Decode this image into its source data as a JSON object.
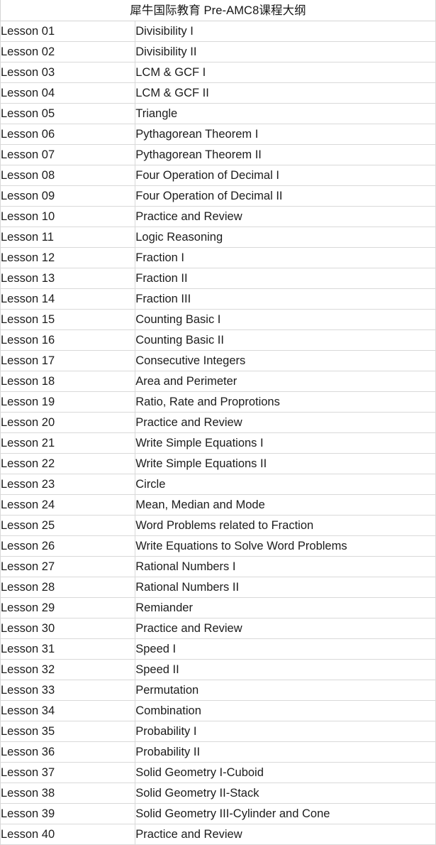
{
  "document": {
    "title": "犀牛国际教育 Pre-AMC8课程大纲",
    "border_color": "#d9d9d9",
    "text_color": "#1c1c1c",
    "background_color": "#ffffff"
  },
  "table": {
    "rows": [
      {
        "lesson": "Lesson 01",
        "topic": "Divisibility I"
      },
      {
        "lesson": "Lesson 02",
        "topic": "Divisibility II"
      },
      {
        "lesson": "Lesson 03",
        "topic": "LCM & GCF I"
      },
      {
        "lesson": "Lesson 04",
        "topic": "LCM & GCF II"
      },
      {
        "lesson": "Lesson 05",
        "topic": "Triangle"
      },
      {
        "lesson": "Lesson 06",
        "topic": "Pythagorean Theorem I"
      },
      {
        "lesson": "Lesson 07",
        "topic": "Pythagorean Theorem II"
      },
      {
        "lesson": "Lesson 08",
        "topic": "Four Operation of Decimal I"
      },
      {
        "lesson": "Lesson 09",
        "topic": "Four Operation of Decimal II"
      },
      {
        "lesson": "Lesson 10",
        "topic": "Practice and Review"
      },
      {
        "lesson": "Lesson 11",
        "topic": "Logic Reasoning"
      },
      {
        "lesson": "Lesson 12",
        "topic": "Fraction I"
      },
      {
        "lesson": "Lesson 13",
        "topic": "Fraction II"
      },
      {
        "lesson": "Lesson 14",
        "topic": "Fraction III"
      },
      {
        "lesson": "Lesson 15",
        "topic": "Counting Basic I"
      },
      {
        "lesson": "Lesson 16",
        "topic": "Counting Basic II"
      },
      {
        "lesson": "Lesson 17",
        "topic": "Consecutive Integers"
      },
      {
        "lesson": "Lesson 18",
        "topic": "Area and Perimeter"
      },
      {
        "lesson": "Lesson 19",
        "topic": "Ratio, Rate and Proprotions"
      },
      {
        "lesson": "Lesson 20",
        "topic": "Practice and Review"
      },
      {
        "lesson": "Lesson 21",
        "topic": "Write Simple Equations I"
      },
      {
        "lesson": "Lesson 22",
        "topic": "Write Simple Equations II"
      },
      {
        "lesson": "Lesson 23",
        "topic": "Circle"
      },
      {
        "lesson": "Lesson 24",
        "topic": "Mean, Median and Mode"
      },
      {
        "lesson": "Lesson 25",
        "topic": "Word Problems related to Fraction"
      },
      {
        "lesson": "Lesson 26",
        "topic": "Write Equations to Solve Word Problems"
      },
      {
        "lesson": "Lesson 27",
        "topic": "Rational Numbers I"
      },
      {
        "lesson": "Lesson 28",
        "topic": "Rational Numbers II"
      },
      {
        "lesson": "Lesson 29",
        "topic": "Remiander"
      },
      {
        "lesson": "Lesson 30",
        "topic": "Practice and Review"
      },
      {
        "lesson": "Lesson 31",
        "topic": "Speed I"
      },
      {
        "lesson": "Lesson 32",
        "topic": "Speed II"
      },
      {
        "lesson": "Lesson 33",
        "topic": "Permutation"
      },
      {
        "lesson": "Lesson 34",
        "topic": "Combination"
      },
      {
        "lesson": "Lesson 35",
        "topic": "Probability I"
      },
      {
        "lesson": "Lesson 36",
        "topic": "Probability II"
      },
      {
        "lesson": "Lesson 37",
        "topic": "Solid Geometry I-Cuboid"
      },
      {
        "lesson": "Lesson 38",
        "topic": "Solid Geometry II-Stack"
      },
      {
        "lesson": "Lesson 39",
        "topic": "Solid Geometry III-Cylinder and Cone"
      },
      {
        "lesson": "Lesson 40",
        "topic": "Practice and Review"
      }
    ]
  }
}
